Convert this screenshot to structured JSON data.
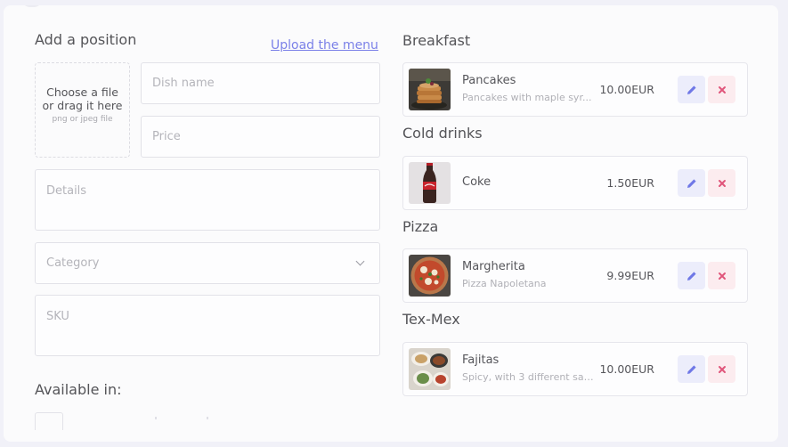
{
  "form": {
    "title": "Add a position",
    "upload_link": "Upload the menu",
    "dropzone": {
      "main": "Choose a file or drag it here",
      "sub": "png or jpeg file"
    },
    "placeholders": {
      "dish_name": "Dish name",
      "price": "Price",
      "details": "Details",
      "category": "Category",
      "sku": "SKU"
    },
    "available_in": "Available in:"
  },
  "menu": [
    {
      "category": "Breakfast",
      "dish": {
        "name": "Pancakes",
        "description": "Pancakes with maple syr...",
        "price": "10.00EUR",
        "image_icon": "pancakes-photo"
      }
    },
    {
      "category": "Cold drinks",
      "dish": {
        "name": "Coke",
        "description": "",
        "price": "1.50EUR",
        "image_icon": "coke-bottle-photo"
      }
    },
    {
      "category": "Pizza",
      "dish": {
        "name": "Margherita",
        "description": "Pizza Napoletana",
        "price": "9.99EUR",
        "image_icon": "pizza-photo"
      }
    },
    {
      "category": "Tex-Mex",
      "dish": {
        "name": "Fajitas",
        "description": "Spicy, with 3 different sau...",
        "price": "10.00EUR",
        "image_icon": "fajitas-photo"
      }
    }
  ],
  "icons": {
    "edit": "pencil-icon",
    "delete": "close-icon",
    "select": "chevron-down-icon"
  },
  "colors": {
    "accent": "#7b81e8",
    "edit_bg": "#ecedfb",
    "delete_bg": "#fcecef",
    "delete_icon": "#e0557a"
  }
}
